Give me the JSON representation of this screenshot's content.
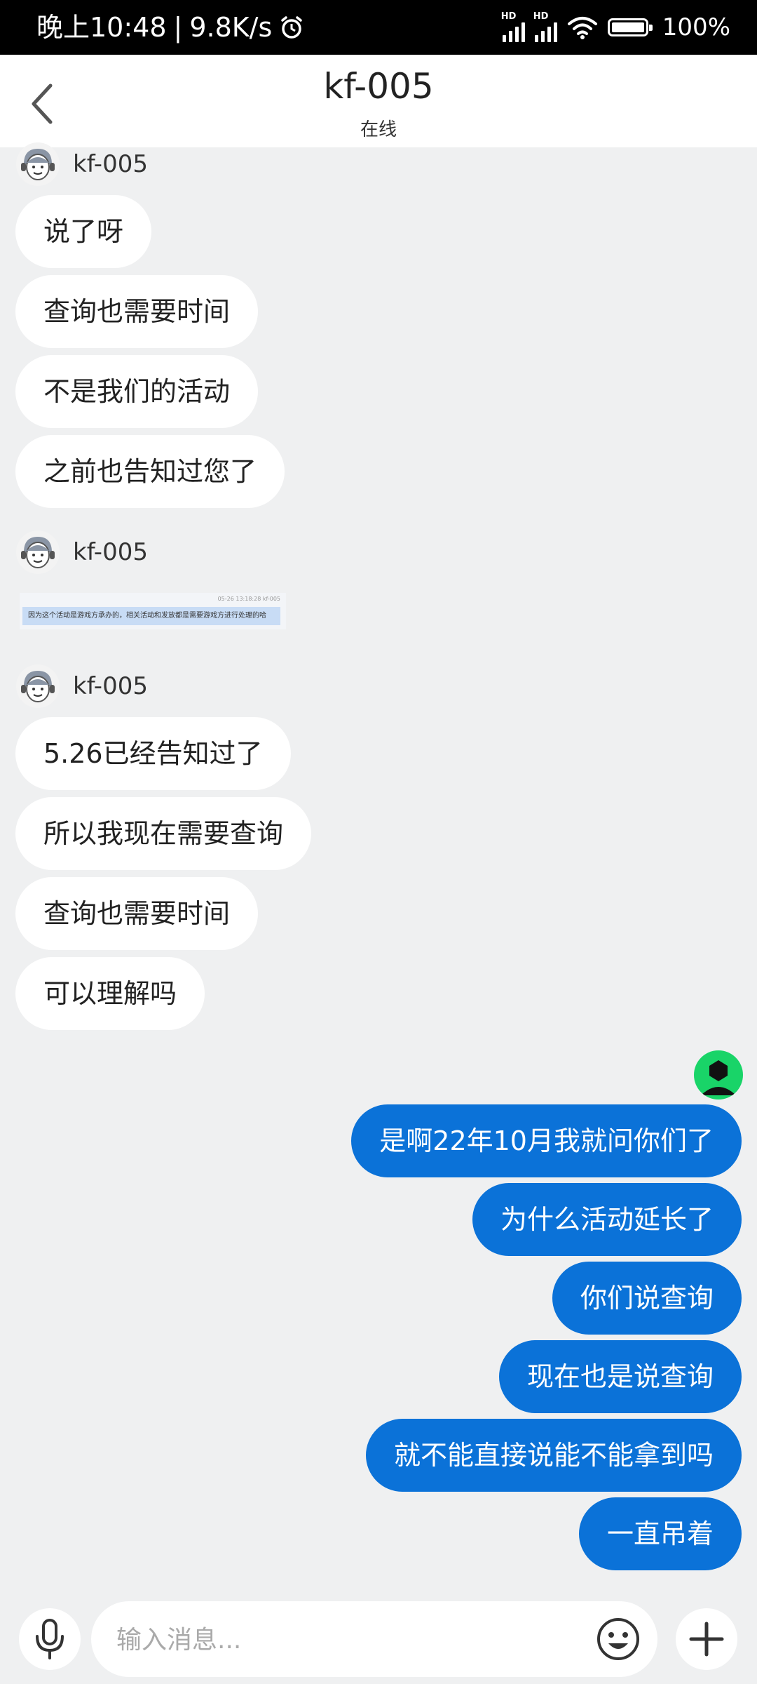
{
  "status_bar": {
    "time": "晚上10:48",
    "separator": "|",
    "speed": "9.8K/s",
    "signal1_label": "HD",
    "signal2_label": "HD",
    "battery": "100%"
  },
  "header": {
    "title": "kf-005",
    "status": "在线"
  },
  "agent": {
    "name": "kf-005"
  },
  "group1": [
    "说了呀",
    "查询也需要时间",
    "不是我们的活动",
    "之前也告知过您了"
  ],
  "image_message": {
    "meta": "05-26 13:18:28 kf-005",
    "text": "因为这个活动是游戏方承办的，相关活动和发放都是需要游戏方进行处理的哈"
  },
  "group3": [
    "5.26已经告知过了",
    "所以我现在需要查询",
    "查询也需要时间",
    "可以理解吗"
  ],
  "user_messages": [
    "是啊22年10月我就问你们了",
    "为什么活动延长了",
    "你们说查询",
    "现在也是说查询",
    "就不能直接说能不能拿到吗",
    "一直吊着"
  ],
  "input": {
    "placeholder": "输入消息..."
  },
  "colors": {
    "accent": "#0b72d8",
    "background": "#eff0f1",
    "user_avatar": "#19d468"
  }
}
